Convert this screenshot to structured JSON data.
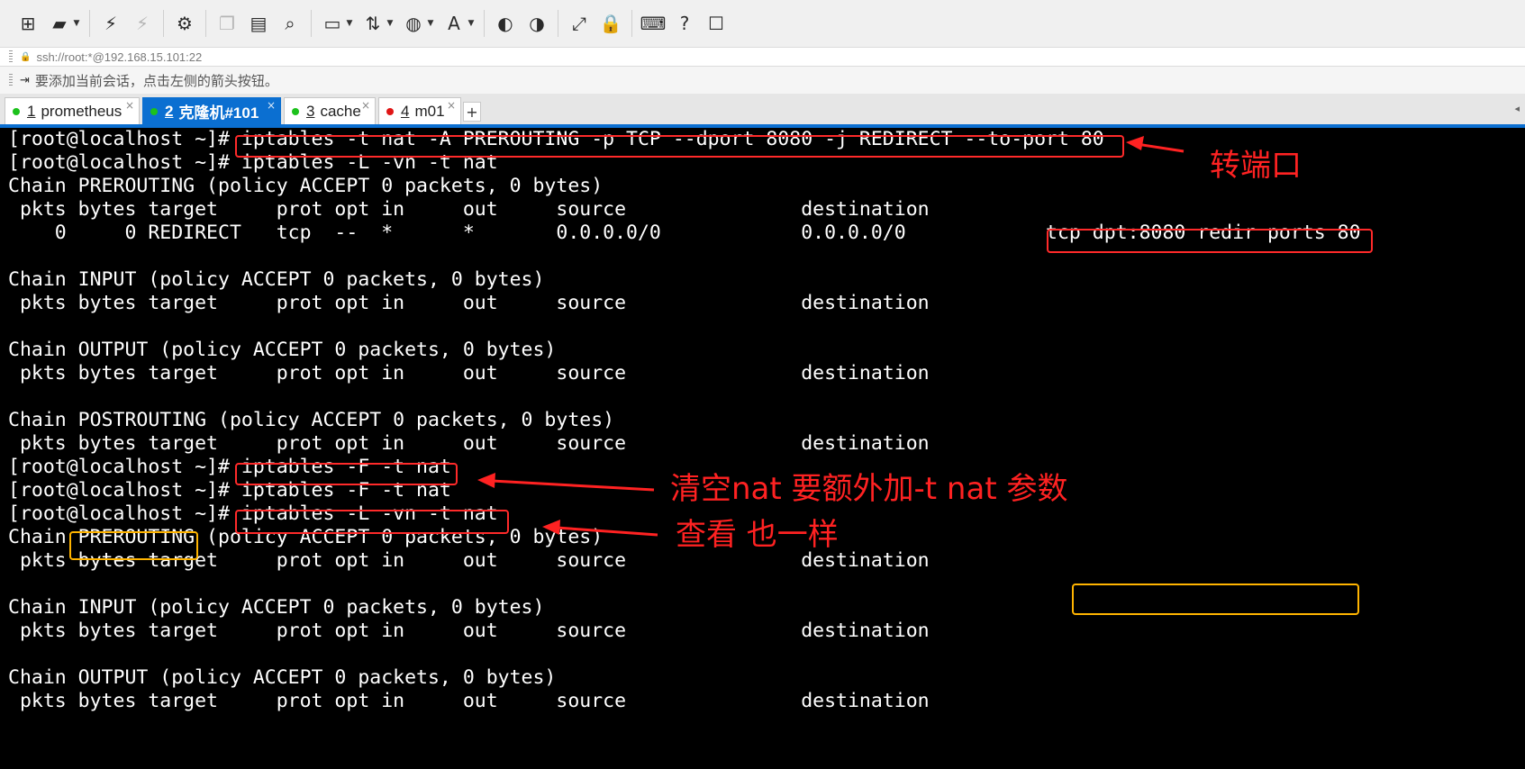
{
  "toolbar": {
    "buttons": [
      {
        "name": "new-session-icon",
        "glyph": "⊞",
        "caret": false,
        "enabled": true
      },
      {
        "name": "open-folder-icon",
        "glyph": "▰",
        "caret": true,
        "enabled": true
      },
      {
        "name": "connect-icon",
        "glyph": "⚡",
        "caret": false,
        "enabled": true
      },
      {
        "name": "disconnect-icon",
        "glyph": "⚡",
        "caret": false,
        "enabled": false
      },
      {
        "name": "properties-icon",
        "glyph": "⚙",
        "caret": false,
        "enabled": true
      },
      {
        "name": "copy-icon",
        "glyph": "❐",
        "caret": false,
        "enabled": false
      },
      {
        "name": "paste-icon",
        "glyph": "▤",
        "caret": false,
        "enabled": true
      },
      {
        "name": "find-icon",
        "glyph": "⌕",
        "caret": false,
        "enabled": true
      },
      {
        "name": "print-icon",
        "glyph": "▭",
        "caret": true,
        "enabled": true
      },
      {
        "name": "transfer-icon",
        "glyph": "⇅",
        "caret": true,
        "enabled": true
      },
      {
        "name": "globe-icon",
        "glyph": "◍",
        "caret": true,
        "enabled": true
      },
      {
        "name": "font-icon",
        "glyph": "A",
        "caret": true,
        "enabled": true
      },
      {
        "name": "xftp-icon",
        "glyph": "◐",
        "caret": false,
        "enabled": true
      },
      {
        "name": "script-icon",
        "glyph": "◑",
        "caret": false,
        "enabled": true
      },
      {
        "name": "fullscreen-icon",
        "glyph": "⤢",
        "caret": false,
        "enabled": true
      },
      {
        "name": "lock-icon",
        "glyph": "🔒",
        "caret": false,
        "enabled": true
      },
      {
        "name": "keyboard-icon",
        "glyph": "⌨",
        "caret": false,
        "enabled": true
      },
      {
        "name": "help-icon",
        "glyph": "?",
        "caret": false,
        "enabled": true
      },
      {
        "name": "chat-icon",
        "glyph": "☐",
        "caret": false,
        "enabled": true
      }
    ]
  },
  "address": {
    "lock_icon": "lock-icon",
    "text": "ssh://root:*@192.168.15.101:22"
  },
  "hint": {
    "icon": "bookmark-icon",
    "text": "要添加当前会话，点击左侧的箭头按钮。"
  },
  "tabs": [
    {
      "number": "1",
      "label": "prometheus",
      "status_color": "#1cc11c",
      "active": false
    },
    {
      "number": "2",
      "label": "克隆机#101",
      "status_color": "#1cc11c",
      "active": true
    },
    {
      "number": "3",
      "label": "cache",
      "status_color": "#1cc11c",
      "active": false
    },
    {
      "number": "4",
      "label": "m01",
      "status_color": "#e01515",
      "active": false
    }
  ],
  "tab_add_label": "+",
  "terminal": {
    "lines": [
      "[root@localhost ~]# iptables -t nat -A PREROUTING -p TCP --dport 8080 -j REDIRECT --to-port 80",
      "[root@localhost ~]# iptables -L -vn -t nat",
      "Chain PREROUTING (policy ACCEPT 0 packets, 0 bytes)",
      " pkts bytes target     prot opt in     out     source               destination",
      "    0     0 REDIRECT   tcp  --  *      *       0.0.0.0/0            0.0.0.0/0            tcp dpt:8080 redir ports 80",
      "",
      "Chain INPUT (policy ACCEPT 0 packets, 0 bytes)",
      " pkts bytes target     prot opt in     out     source               destination",
      "",
      "Chain OUTPUT (policy ACCEPT 0 packets, 0 bytes)",
      " pkts bytes target     prot opt in     out     source               destination",
      "",
      "Chain POSTROUTING (policy ACCEPT 0 packets, 0 bytes)",
      " pkts bytes target     prot opt in     out     source               destination",
      "[root@localhost ~]# iptables -F -t nat",
      "[root@localhost ~]# iptables -F -t nat",
      "[root@localhost ~]# iptables -L -vn -t nat",
      "Chain PREROUTING (policy ACCEPT 0 packets, 0 bytes)",
      " pkts bytes target     prot opt in     out     source               destination",
      "",
      "Chain INPUT (policy ACCEPT 0 packets, 0 bytes)",
      " pkts bytes target     prot opt in     out     source               destination",
      "",
      "Chain OUTPUT (policy ACCEPT 0 packets, 0 bytes)",
      " pkts bytes target     prot opt in     out     source               destination"
    ]
  },
  "annotations": {
    "port_redirect_note": "转端口",
    "flush_note": "清空nat 要额外加-t nat 参数",
    "list_note": "查看 也一样",
    "box_color_red": "#ff2a2a",
    "box_color_yellow": "#ffb400"
  }
}
